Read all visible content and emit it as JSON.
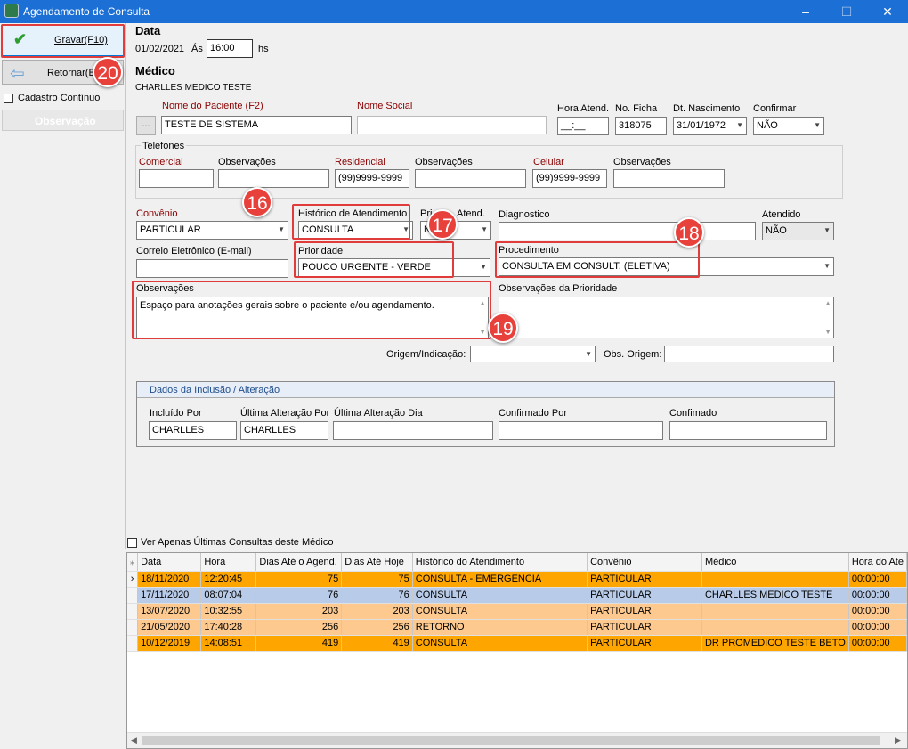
{
  "window": {
    "title": "Agendamento de Consulta",
    "min": "–",
    "max": "☐",
    "close": "✕"
  },
  "sidebar": {
    "gravar": "Gravar(F10)",
    "retornar": "Retornar(E",
    "cadastro_continuo": "Cadastro Contínuo",
    "observacao": "Observação"
  },
  "data_section": {
    "heading": "Data",
    "date": "01/02/2021",
    "as_label": "Ás",
    "time": "16:00",
    "hs": "hs"
  },
  "medico": {
    "heading": "Médico",
    "name": "CHARLLES MEDICO TESTE"
  },
  "paciente": {
    "btn": "...",
    "nome_label": "Nome do Paciente (F2)",
    "nome": "TESTE DE SISTEMA",
    "nome_social_label": "Nome Social",
    "nome_social": "",
    "hora_label": "Hora Atend.",
    "hora": "__:__",
    "ficha_label": "No. Ficha",
    "ficha": "318075",
    "nasc_label": "Dt. Nascimento",
    "nasc": "31/01/1972",
    "confirmar_label": "Confirmar",
    "confirmar": "NÃO"
  },
  "telefones": {
    "group": "Telefones",
    "comercial_label": "Comercial",
    "obs1_label": "Observações",
    "residencial_label": "Residencial",
    "residencial": "(99)9999-9999",
    "obs2_label": "Observações",
    "celular_label": "Celular",
    "celular": "(99)9999-9999",
    "obs3_label": "Observações"
  },
  "atendimento": {
    "convenio_label": "Convênio",
    "convenio": "PARTICULAR",
    "historico_label": "Histórico de Atendimento",
    "historico": "CONSULTA",
    "primeiro_label": "Pri",
    "primeiro_label2": "Atend.",
    "primeiro": "N",
    "diagnostico_label": "Diagnostico",
    "atendido_label": "Atendido",
    "atendido": "NÃO",
    "email_label": "Correio Eletrônico (E-mail)",
    "prioridade_label": "Prioridade",
    "prioridade": "POUCO URGENTE - VERDE",
    "procedimento_label": "Procedimento",
    "procedimento": "CONSULTA EM CONSULT. (ELETIVA)",
    "obs_label": "Observações",
    "obs": "Espaço para anotações gerais sobre o paciente e/ou agendamento.",
    "obs_prio_label": "Observações da Prioridade",
    "origem_label": "Origem/Indicação:",
    "obs_origem_label": "Obs. Origem:"
  },
  "inclusao": {
    "title": "Dados da Inclusão / Alteração",
    "incluido_label": "Incluído Por",
    "incluido": "CHARLLES",
    "ult_alt_label": "Última Alteração Por",
    "ult_alt": "CHARLLES",
    "ult_dia_label": "Última Alteração Dia",
    "confirmado_por_label": "Confirmado Por",
    "confirmado_label": "Confimado"
  },
  "ver_apenas": "Ver Apenas Últimas Consultas deste Médico",
  "badges": {
    "b16": "16",
    "b17": "17",
    "b18": "18",
    "b19": "19",
    "b20": "20"
  },
  "grid": {
    "columns": [
      "Data",
      "Hora",
      "Dias Até o Agend.",
      "Dias Até Hoje",
      "Histórico do Atendimento",
      "Convênio",
      "Médico",
      "Hora do Ate"
    ],
    "rows": [
      [
        "18/11/2020",
        "12:20:45",
        "75",
        "75",
        "CONSULTA - EMERGENCIA",
        "PARTICULAR",
        "",
        "00:00:00"
      ],
      [
        "17/11/2020",
        "08:07:04",
        "76",
        "76",
        "CONSULTA",
        "PARTICULAR",
        "CHARLLES MEDICO TESTE",
        "00:00:00"
      ],
      [
        "13/07/2020",
        "10:32:55",
        "203",
        "203",
        "CONSULTA",
        "PARTICULAR",
        "",
        "00:00:00"
      ],
      [
        "21/05/2020",
        "17:40:28",
        "256",
        "256",
        "RETORNO",
        "PARTICULAR",
        "",
        "00:00:00"
      ],
      [
        "10/12/2019",
        "14:08:51",
        "419",
        "419",
        "CONSULTA",
        "PARTICULAR",
        "DR PROMEDICO TESTE BETO",
        "00:00:00"
      ]
    ]
  }
}
